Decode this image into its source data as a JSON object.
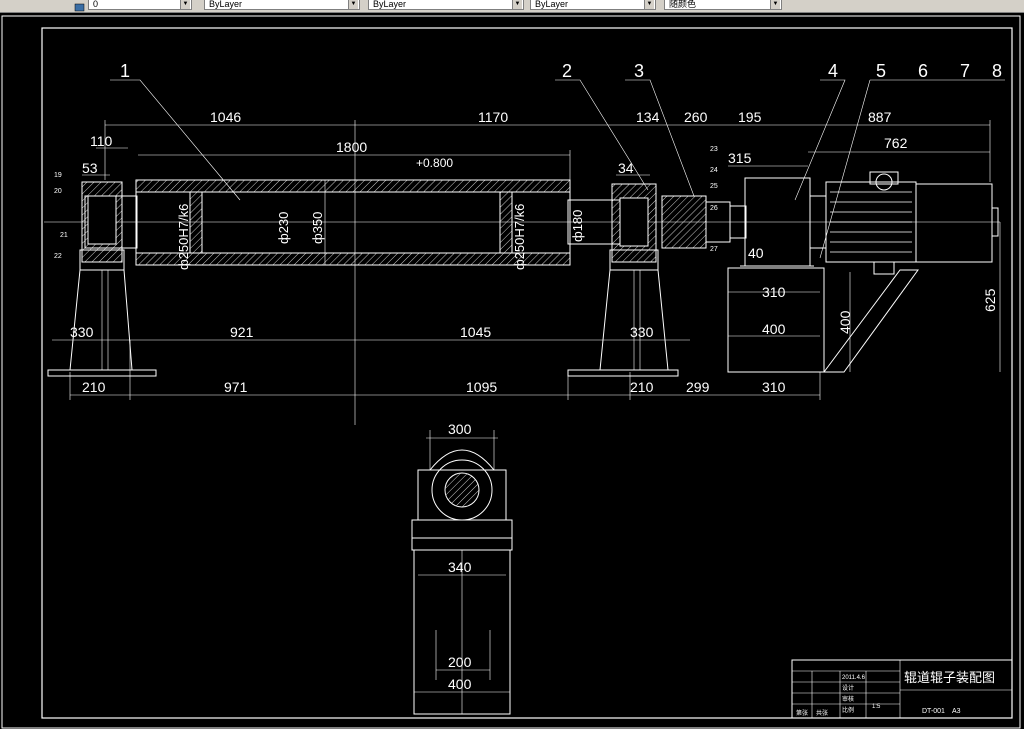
{
  "toolbar": {
    "layer_combo": "0",
    "color_combo": "ByLayer",
    "linetype_combo": "ByLayer",
    "lineweight_combo": "ByLayer",
    "plotstyle_combo": "随颜色"
  },
  "drawing": {
    "part_numbers": [
      "1",
      "2",
      "3",
      "4",
      "5",
      "6",
      "7",
      "8"
    ],
    "small_callouts_left": [
      "19",
      "20",
      "21",
      "22"
    ],
    "small_callouts_right": [
      "23",
      "24",
      "25",
      "26",
      "27"
    ],
    "dims_top": {
      "d110": "110",
      "d53": "53",
      "d1046": "1046",
      "d1170": "1170",
      "d134": "134",
      "d260": "260",
      "d195": "195",
      "d887": "887",
      "d1800": "1800",
      "d762": "762",
      "d315": "315",
      "d34": "34",
      "d40": "40",
      "d625": "625"
    },
    "tolerance": "+0.800",
    "diameters": {
      "bore_left": "ф250H7/k6",
      "bore_right": "ф250H7/k6",
      "d230": "ф230",
      "d350": "ф350",
      "d180": "ф180"
    },
    "dims_bottom": {
      "d330a": "330",
      "d921": "921",
      "d1045": "1045",
      "d330b": "330",
      "d210a": "210",
      "d971": "971",
      "d1095": "1095",
      "d210b": "210",
      "d299": "299",
      "d310a": "310",
      "d310b": "310",
      "d400a": "400",
      "d400v": "400"
    },
    "section_view": {
      "d300": "300",
      "d340": "340",
      "d200": "200",
      "d400": "400"
    }
  },
  "title_block": {
    "title": "辊道辊子装配图",
    "date": "2011.4.6",
    "scale": "1:5",
    "row_labels": [
      "设计",
      "审核",
      "比例",
      "共张",
      "第张"
    ],
    "drawing_no": "DT-001",
    "sheet": "A3"
  },
  "colors": {
    "background": "#000000",
    "lines": "#ffffff",
    "toolbar": "#d4d0c8"
  }
}
